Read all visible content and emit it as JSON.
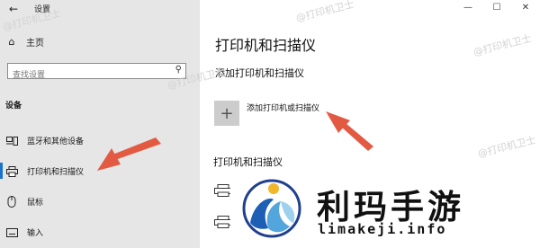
{
  "window": {
    "title": "设置",
    "back_icon": "←",
    "minimize_icon": "—",
    "maximize_icon": "☐",
    "close_icon": "✕"
  },
  "sidebar": {
    "home_label": "主页",
    "home_icon": "⌂",
    "search_placeholder": "查找设置",
    "search_icon": "⚲",
    "section_label": "设备",
    "items": [
      {
        "label": "蓝牙和其他设备",
        "icon": "bluetooth-devices-icon"
      },
      {
        "label": "打印机和扫描仪",
        "icon": "printer-icon",
        "selected": true
      },
      {
        "label": "鼠标",
        "icon": "mouse-icon"
      },
      {
        "label": "输入",
        "icon": "keyboard-icon"
      }
    ]
  },
  "main": {
    "title": "打印机和扫描仪",
    "add_heading": "添加打印机和扫描仪",
    "add_label": "添加打印机或扫描仪",
    "add_icon": "+",
    "list_heading": "打印机和扫描仪"
  },
  "watermarks": [
    "@打印机卫士",
    "@打印机卫士",
    "@打印机卫士",
    "@打印机卫士",
    "@打印机卫士"
  ],
  "overlay": {
    "brand_name": "利玛手游",
    "brand_url": "limakeji.info"
  },
  "colors": {
    "sidebar_bg": "#e6e6e6",
    "accent": "#1a73c9",
    "arrow": "#e35a43"
  }
}
